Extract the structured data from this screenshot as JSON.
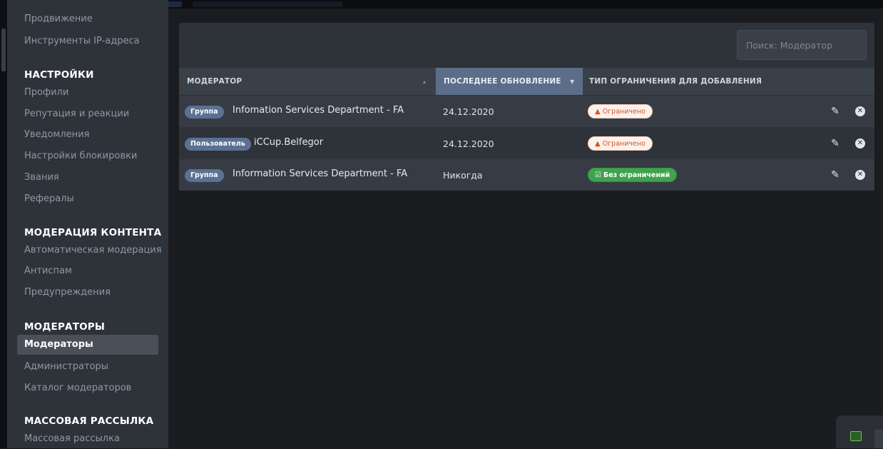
{
  "sidebar": {
    "top_items": [
      "Продвижение",
      "Инструменты IP-адреса"
    ],
    "sections": [
      {
        "title": "НАСТРОЙКИ",
        "items": [
          "Профили",
          "Репутация и реакции",
          "Уведомления",
          "Настройки блокировки",
          "Звания",
          "Рефералы"
        ]
      },
      {
        "title": "МОДЕРАЦИЯ КОНТЕНТА",
        "items": [
          "Автоматическая модерация",
          "Антиспам",
          "Предупреждения"
        ]
      },
      {
        "title": "МОДЕРАТОРЫ",
        "items": [
          "Модераторы",
          "Администраторы",
          "Каталог модераторов"
        ]
      },
      {
        "title": "МАССОВАЯ РАССЫЛКА",
        "items": [
          "Массовая рассылка"
        ]
      }
    ],
    "active_item": "Модераторы"
  },
  "search": {
    "placeholder": "Поиск: Модератор"
  },
  "table": {
    "headers": {
      "moderator": "МОДЕРАТОР",
      "last_update": "ПОСЛЕДНЕЕ ОБНОВЛЕНИЕ",
      "restriction": "ТИП ОГРАНИЧЕНИЯ ДЛЯ ДОБАВЛЕНИЯ"
    },
    "rows": [
      {
        "tag": "Группа",
        "name": "Infomation Services Department - FA",
        "date": "24.12.2020",
        "status": "Ограничено",
        "status_type": "restricted"
      },
      {
        "tag": "Пользователь",
        "name": "iCCup.Belfegor",
        "date": "24.12.2020",
        "status": "Ограничено",
        "status_type": "restricted"
      },
      {
        "tag": "Группа",
        "name": "Information Services Department - FA",
        "date": "Никогда",
        "status": "Без ограничений",
        "status_type": "free"
      }
    ]
  },
  "colors": {
    "restricted": "#d4551f",
    "free": "#3fa34d",
    "tag": "#5b7193",
    "sorted_header": "#5b6d89"
  },
  "icons": {
    "edit": "pencil-icon",
    "delete": "close-circle-icon",
    "restricted": "warning-icon",
    "free": "check-square-icon"
  }
}
